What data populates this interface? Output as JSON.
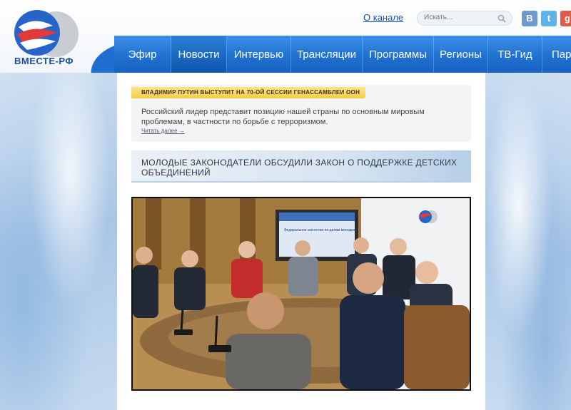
{
  "logo": {
    "text": "ВМЕСТЕ-РФ"
  },
  "header": {
    "top_link": "О канале",
    "search_placeholder": "Искать..."
  },
  "social": {
    "vk": "B",
    "twitter": "t",
    "google": "g"
  },
  "nav": {
    "items": [
      "Эфир",
      "Новости",
      "Интервью",
      "Трансляции",
      "Программы",
      "Регионы",
      "ТВ-Гид",
      "Парт"
    ],
    "active_index": 1
  },
  "promo": {
    "tag": "ВЛАДИМИР ПУТИН ВЫСТУПИТ НА 70-ОЙ СЕССИИ ГЕНАССАМБЛЕИ ООН",
    "text": "Российский лидер представит позицию нашей страны по основным мировым проблемам, в частности по борьбе с терроризмом.",
    "more": "Читать далее"
  },
  "headline": {
    "title": "МОЛОДЫЕ ЗАКОНОДАТЕЛИ ОБСУДИЛИ ЗАКОН О ПОДДЕРЖКЕ ДЕТСКИХ ОБЪЕДИНЕНИЙ"
  },
  "video": {
    "screen_text": "Федеральное агентство по делам молодежи"
  },
  "colors": {
    "brand_blue": "#1e6fd0",
    "tag_yellow": "#f6cc44",
    "link_blue": "#1c55b0"
  }
}
